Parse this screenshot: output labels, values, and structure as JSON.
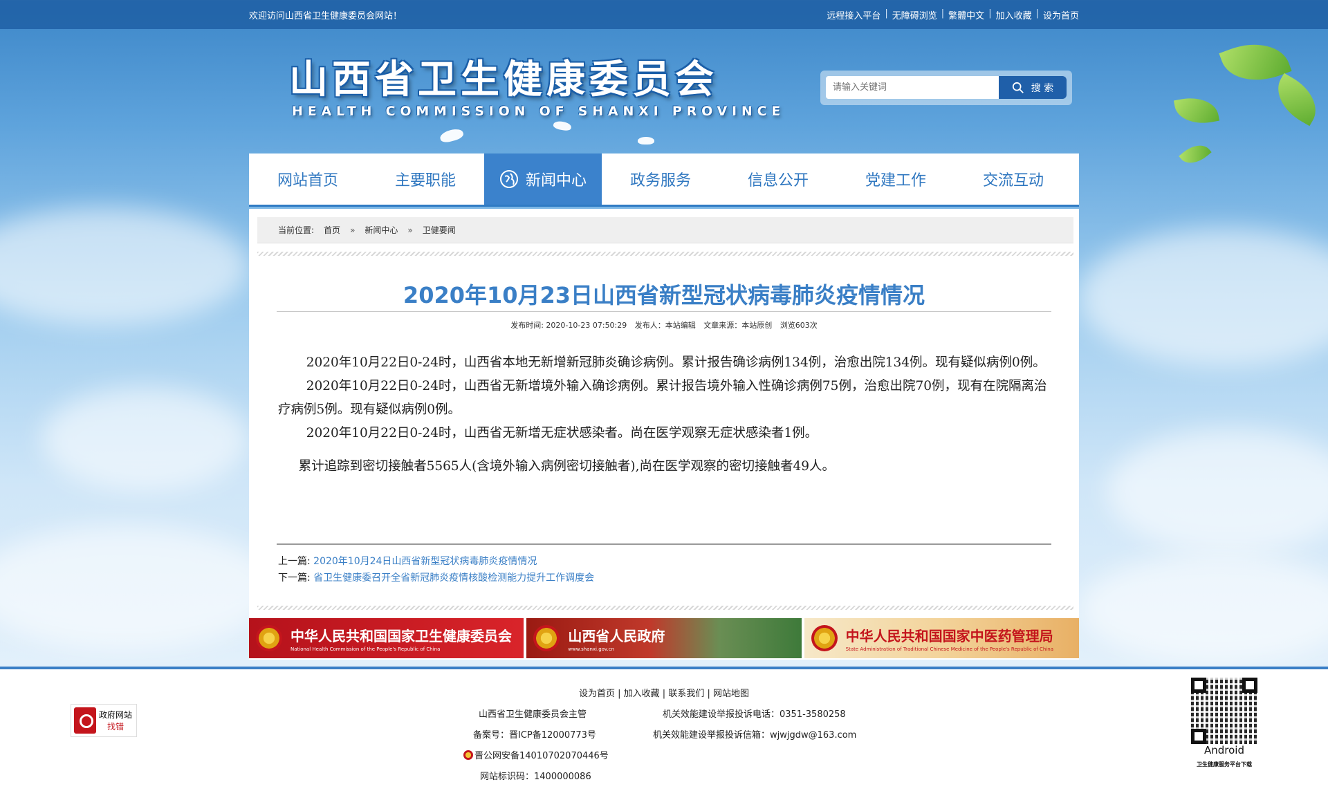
{
  "topbar": {
    "welcome": "欢迎访问山西省卫生健康委员会网站！",
    "links": [
      "远程接入平台",
      "无障碍浏览",
      "繁體中文",
      "加入收藏",
      "设为首页"
    ]
  },
  "header": {
    "title_cn": "山西省卫生健康委员会",
    "title_en": "HEALTH COMMISSION OF SHANXI PROVINCE",
    "search_placeholder": "请输入关键词",
    "search_button": "搜 索"
  },
  "nav": {
    "items": [
      "网站首页",
      "主要职能",
      "新闻中心",
      "政务服务",
      "信息公开",
      "党建工作",
      "交流互动"
    ],
    "active_index": 2
  },
  "breadcrumb": {
    "label": "当前位置:",
    "items": [
      "首页",
      "新闻中心",
      "卫健要闻"
    ],
    "separator": "»"
  },
  "article": {
    "title": "2020年10月23日山西省新型冠状病毒肺炎疫情情况",
    "meta": {
      "publish_time": "发布时间:  2020-10-23 07:50:29",
      "publisher": "发布人：本站编辑",
      "source": "文章来源：本站原创",
      "views": "浏览603次"
    },
    "paragraphs": [
      "2020年10月22日0-24时，山西省本地无新增新冠肺炎确诊病例。累计报告确诊病例134例，治愈出院134例。现有疑似病例0例。",
      "2020年10月22日0-24时，山西省无新增境外输入确诊病例。累计报告境外输入性确诊病例75例，治愈出院70例，现有在院隔离治疗病例5例。现有疑似病例0例。",
      "2020年10月22日0-24时，山西省无新增无症状感染者。尚在医学观察无症状感染者1例。"
    ],
    "last_paragraph": "累计追踪到密切接触者5565人(含境外输入病例密切接触者),尚在医学观察的密切接触者49人。",
    "prev_label": "上一篇:",
    "prev_title": "2020年10月24日山西省新型冠状病毒肺炎疫情情况",
    "next_label": "下一篇:",
    "next_title": "省卫生健康委召开全省新冠肺炎疫情核酸检测能力提升工作调度会"
  },
  "banners": [
    {
      "title": "中华人民共和国国家卫生健康委员会",
      "subtitle": "National Health Commission of the People's Republic of China"
    },
    {
      "title": "山西省人民政府",
      "subtitle": "www.shanxi.gov.cn"
    },
    {
      "title": "中华人民共和国国家中医药管理局",
      "subtitle": "State Administration of Traditional Chinese Medicine of the People's Republic of China"
    }
  ],
  "footer": {
    "links": "设为首页 | 加入收藏 | 联系我们 | 网站地图",
    "sponsor": "山西省卫生健康委员会主管",
    "icp": "备案号：晋ICP备12000773号",
    "police": "晋公网安备14010702070446号",
    "site_code": "网站标识码：1400000086",
    "phone": "机关效能建设举报投诉电话：0351-3580258",
    "email": "机关效能建设举报投诉信箱：wjwjgdw@163.com",
    "gov_badge_line1": "政府网站",
    "gov_badge_line2": "找错",
    "app_label": "Android",
    "app_sub": "卫生健康服务平台下载"
  }
}
